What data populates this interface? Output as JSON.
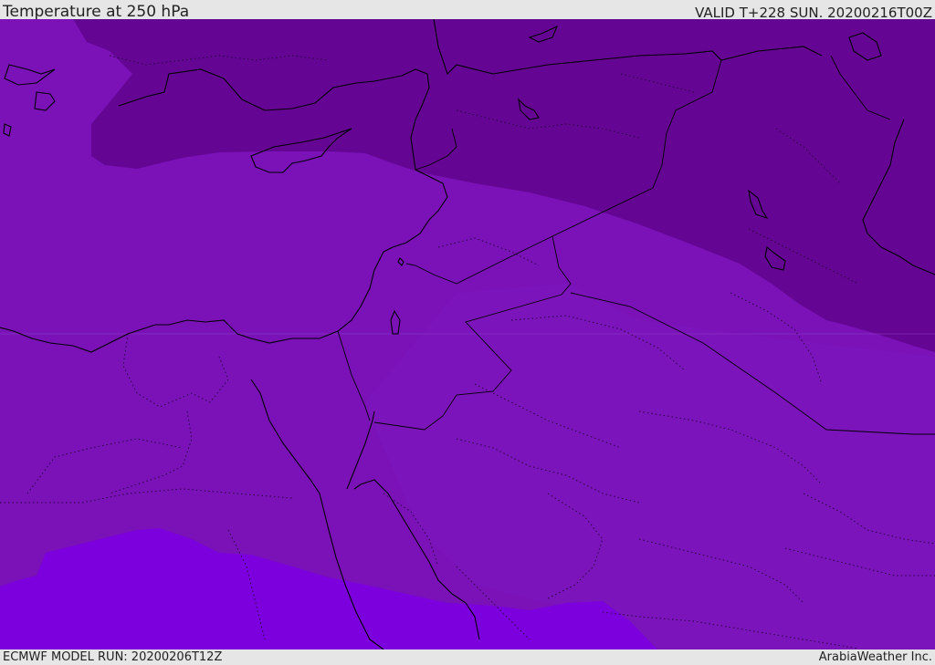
{
  "header": {
    "title": "Temperature at 250 hPa",
    "valid_label": "VALID T+228 SUN. 20200216T00Z"
  },
  "footer": {
    "model_run": "ECMWF MODEL RUN: 20200206T12Z",
    "attribution": "ArabiaWeather Inc."
  },
  "map": {
    "region": "Eastern Mediterranean / Middle East",
    "colors": {
      "cold_band": "#650594",
      "mid_band": "#7a12b8",
      "mid_band_light": "#7c14bb",
      "warm_band": "#7b00dd",
      "coastline": "#000000",
      "border": "#000000"
    }
  }
}
